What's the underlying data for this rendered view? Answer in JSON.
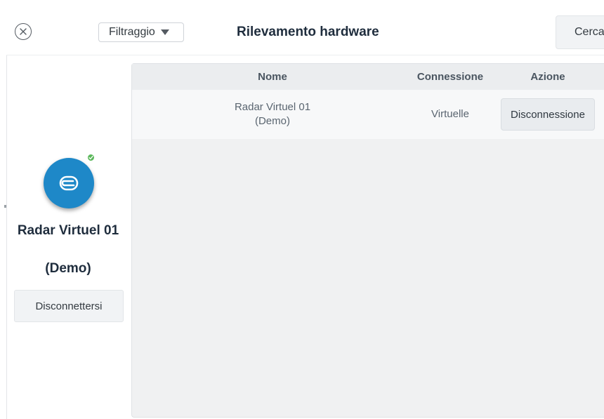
{
  "header": {
    "title": "Rilevamento hardware",
    "filter_label": "Filtraggio",
    "search_label": "Cerca"
  },
  "device": {
    "name_line1": "Radar Virtuel 01",
    "name_line2": "(Demo)",
    "status": "connected",
    "disconnect_label": "Disconnettersi"
  },
  "table": {
    "columns": [
      "Nome",
      "Connessione",
      "Azione"
    ],
    "rows": [
      {
        "name_line1": "Radar Virtuel 01",
        "name_line2": "(Demo)",
        "connection": "Virtuelle",
        "action": "Disconnessione"
      }
    ]
  },
  "icons": {
    "close": "close-icon",
    "caret": "chevron-down-icon",
    "device": "radar-logo-icon",
    "status": "check-icon"
  },
  "colors": {
    "accent": "#1e88c8",
    "status_ok": "#5cb85c"
  }
}
